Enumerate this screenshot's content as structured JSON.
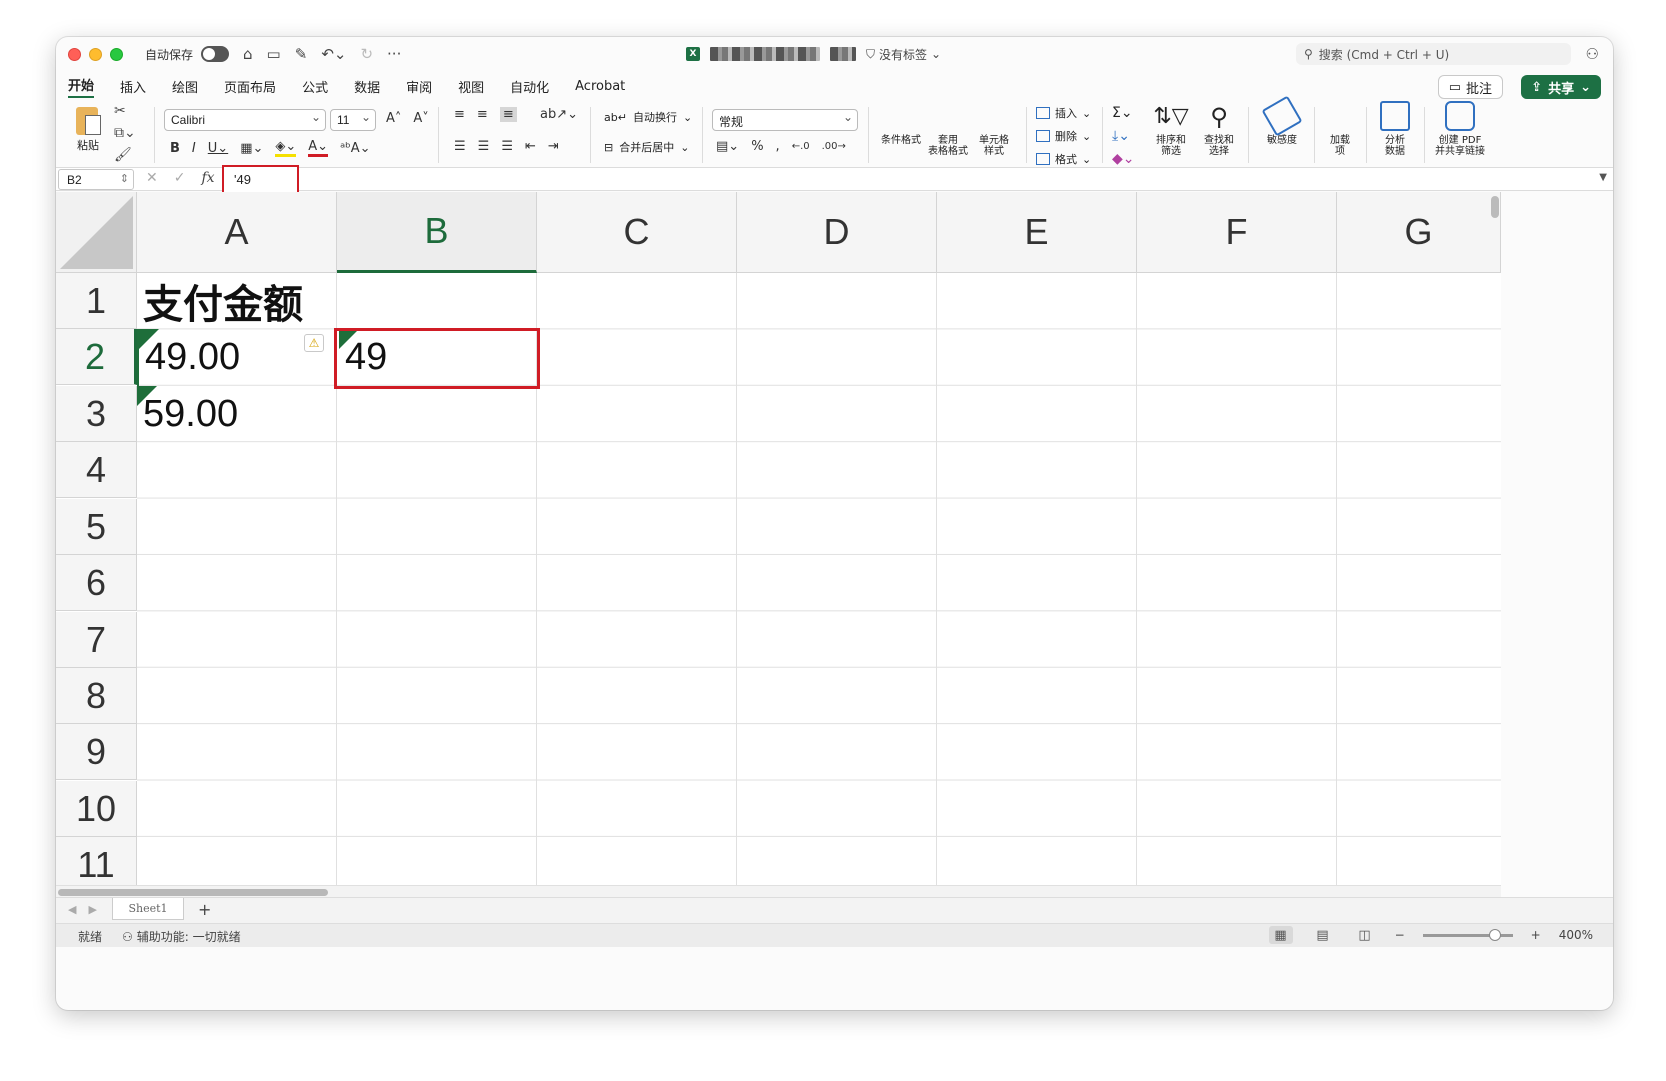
{
  "window": {
    "autosave_label": "自动保存",
    "sensitivity_label": "没有标签",
    "search_placeholder": "搜索 (Cmd + Ctrl + U)"
  },
  "tabs": [
    "开始",
    "插入",
    "绘图",
    "页面布局",
    "公式",
    "数据",
    "审阅",
    "视图",
    "自动化",
    "Acrobat"
  ],
  "active_tab": "开始",
  "actions": {
    "comment_label": "批注",
    "share_label": "共享"
  },
  "ribbon": {
    "paste_label": "粘贴",
    "font_name": "Calibri",
    "font_size": "11",
    "wrap_text": "自动换行",
    "merge_center": "合并后居中",
    "number_format": "常规",
    "conditional_format": "条件格式",
    "table_format": "套用\n表格格式",
    "cell_styles": "单元格\n样式",
    "insert": "插入",
    "delete": "删除",
    "format": "格式",
    "sort_filter": "排序和\n筛选",
    "find_select": "查找和\n选择",
    "sensitivity": "敏感度",
    "addins": "加载\n项",
    "analyze": "分析\n数据",
    "create_pdf": "创建 PDF\n并共享链接"
  },
  "formula_bar": {
    "name_box": "B2",
    "content": "'49"
  },
  "columns": [
    "A",
    "B",
    "C",
    "D",
    "E",
    "F",
    "G"
  ],
  "active_column": "B",
  "rows": [
    "1",
    "2",
    "3",
    "4",
    "5",
    "6",
    "7",
    "8",
    "9",
    "10",
    "11"
  ],
  "active_row": "2",
  "cells": {
    "A1": "支付金额",
    "A2": "49.00",
    "A3": "59.00",
    "B2": "49"
  },
  "sheet_tab": "Sheet1",
  "status": {
    "ready": "就绪",
    "accessibility": "辅助功能: 一切就绪",
    "zoom": "400%",
    "zoom_fraction": 0.85
  },
  "colors": {
    "accent": "#1d7044",
    "highlight": "#d01c25",
    "error_triangle": "#1e6e3a"
  }
}
